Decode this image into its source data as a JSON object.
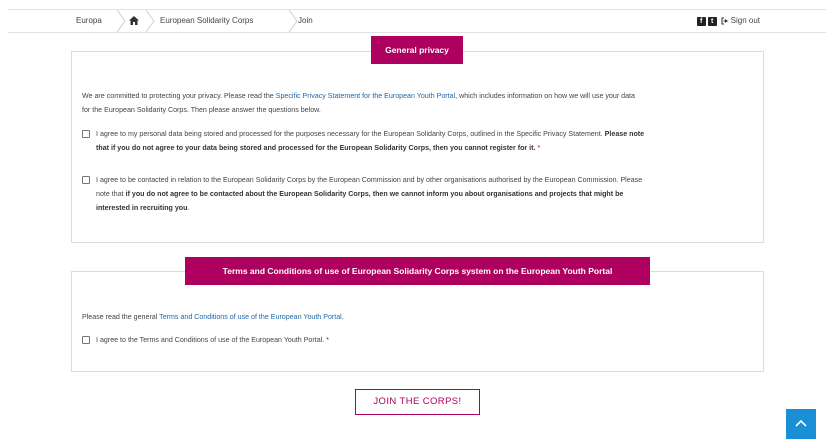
{
  "breadcrumb": {
    "items": [
      "Europa",
      "European Solidarity Corps",
      "Join"
    ]
  },
  "header": {
    "sign_out": "Sign out",
    "icons": [
      "facebook-icon",
      "twitter-icon",
      "sign-out-icon"
    ]
  },
  "privacy": {
    "title": "General privacy",
    "intro_pre": "We are committed to protecting your privacy. Please read the ",
    "intro_link": "Specific Privacy Statement for the European Youth Portal",
    "intro_post1": ", which includes information on how we will use your data",
    "intro_post2": "for the European Solidarity Corps. Then please answer the questions below.",
    "consent1_line1": "I agree to my personal data being stored and processed for the purposes necessary for the European Solidarity Corps, outlined in the Specific Privacy Statement.",
    "consent1_bold1": " Please note",
    "consent1_bold2": "that if you do not agree to your data being stored and processed for the European Solidarity Corps, then you cannot register for it.",
    "consent2_line1": "I agree to be contacted in relation to the European Solidarity Corps by the European Commission and by other organisations authorised by the European Commission. Please",
    "consent2_line2_pre": "note that ",
    "consent2_bold1": "if you do not agree to be contacted about the European Solidarity Corps, then we cannot inform you about organisations and projects that might be",
    "consent2_bold2": "interested in recruiting you",
    "consent2_end": "."
  },
  "terms": {
    "title": "Terms and Conditions of use of European Solidarity Corps system on the European Youth Portal",
    "intro_pre": "Please read the general ",
    "intro_link": "Terms and Conditions of use of the European Youth Portal",
    "intro_post": ".",
    "consent": "I agree to the Terms and Conditions of use of the European Youth Portal."
  },
  "required_mark": "*",
  "join_button": "JOIN THE CORPS!",
  "colors": {
    "accent": "#ad005f",
    "link": "#2166a8",
    "to_top": "#1a8fd6"
  }
}
